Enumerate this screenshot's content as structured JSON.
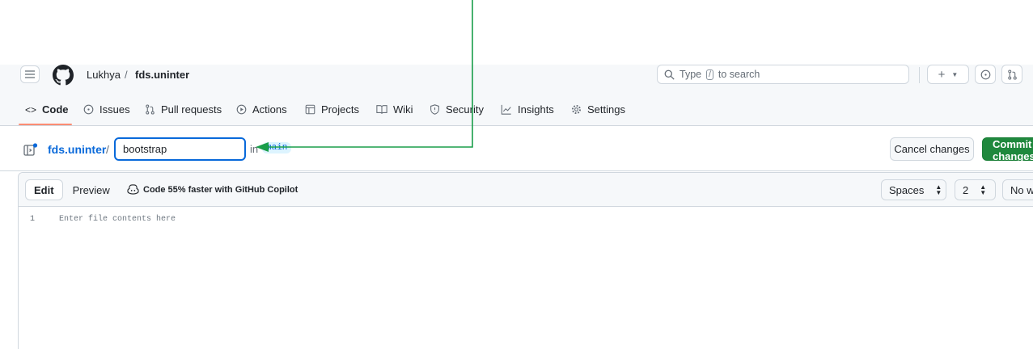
{
  "header": {
    "owner": "Lukhya",
    "separator": "/",
    "repo": "fds.uninter",
    "search": {
      "prefix": "Type",
      "key": "/",
      "suffix": "to search"
    }
  },
  "tabs": [
    {
      "label": "Code",
      "icon": "code-icon"
    },
    {
      "label": "Issues",
      "icon": "issue-opened-icon"
    },
    {
      "label": "Pull requests",
      "icon": "git-pull-request-icon"
    },
    {
      "label": "Actions",
      "icon": "play-icon"
    },
    {
      "label": "Projects",
      "icon": "table-icon"
    },
    {
      "label": "Wiki",
      "icon": "book-icon"
    },
    {
      "label": "Security",
      "icon": "shield-icon"
    },
    {
      "label": "Insights",
      "icon": "graph-icon"
    },
    {
      "label": "Settings",
      "icon": "gear-icon"
    }
  ],
  "path": {
    "repo": "fds.uninter",
    "separator": "/",
    "filename_value": "bootstrap",
    "in_text": "in",
    "branch": "main"
  },
  "actions": {
    "cancel": "Cancel changes",
    "commit": "Commit changes..."
  },
  "editor": {
    "edit_tab": "Edit",
    "preview_tab": "Preview",
    "copilot": "Code 55% faster with GitHub Copilot",
    "indent_mode": "Spaces",
    "indent_size": "2",
    "wrap_mode": "No wrap",
    "line_number": "1",
    "placeholder": "Enter file contents here"
  },
  "colors": {
    "accent": "#0969da",
    "commit_green": "#1f883d",
    "tab_underline": "#fd8c73",
    "annotation_arrow": "#1a9e4a"
  }
}
